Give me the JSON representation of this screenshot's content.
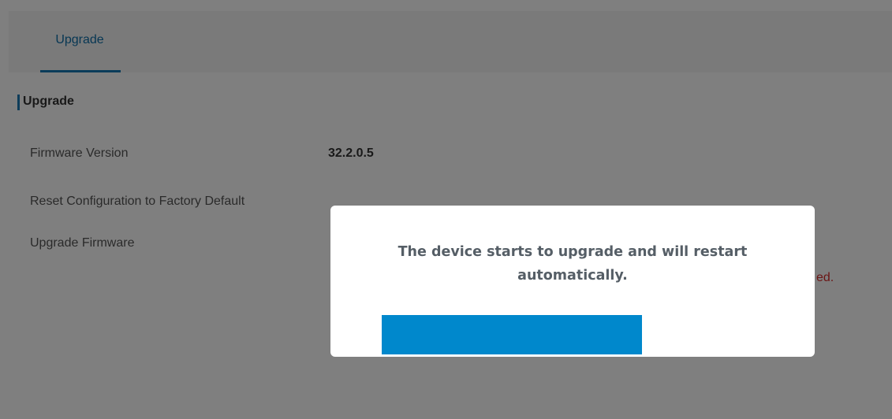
{
  "tabs": [
    {
      "label": "Upgrade",
      "active": true
    }
  ],
  "section": {
    "title": "Upgrade"
  },
  "rows": {
    "firmware_version": {
      "label": "Firmware Version",
      "value": "32.2.0.5"
    },
    "reset_config": {
      "label": "Reset Configuration to Factory Default"
    },
    "upgrade_firmware": {
      "label": "Upgrade Firmware"
    }
  },
  "partial_error_text": "ed.",
  "dialog": {
    "message": "The device starts to upgrade and will restart automatically.",
    "progress_percent": 100
  },
  "colors": {
    "accent": "#1478b5",
    "tab_text": "#0f6fa8",
    "error": "#d62c2c",
    "progress": "#0088cc",
    "overlay": "rgba(0,0,0,0.5)"
  }
}
